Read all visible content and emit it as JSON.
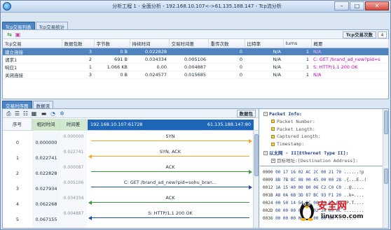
{
  "window": {
    "title": "分析工程 1 - 全面分析 - 192.168.10.107<->61.135.188.147 - Tcp流分析",
    "minimize": "–",
    "maximize": "□",
    "close": "✕"
  },
  "top_tabs": [
    "Tcp交易列表",
    "Tcp交易统计"
  ],
  "top_toolbar": {
    "count_label": "Tcp交易次数",
    "count_value": "4"
  },
  "tcp_table": {
    "headers": [
      "Tcp交易",
      "数据包数",
      "字节数",
      "持续时间",
      "交易时间差",
      "重传次数",
      "比特率",
      "turns",
      "概要"
    ],
    "rows": [
      {
        "name": "建立连接",
        "packets": "3",
        "bytes": "0 B",
        "duration": "0.022828",
        "gap": "",
        "retrans": "0",
        "bitrate": "N/A",
        "turns": "1",
        "summary": "N/A"
      },
      {
        "name": "请求1",
        "packets": "2",
        "bytes": "691 B",
        "duration": "0.034334",
        "gap": "0.005106",
        "retrans": "0",
        "bitrate": "N/A",
        "turns": "1",
        "summary": "C: GET /brand_ad_new?pid=s"
      },
      {
        "name": "响应1",
        "packets": "1",
        "bytes": "1.066 KB",
        "duration": "0.00",
        "gap": "0.004887",
        "retrans": "0",
        "bitrate": "N/A",
        "turns": "1",
        "summary": "S: HTTP/1.1 200 OK"
      },
      {
        "name": "关闭连接",
        "packets": "3",
        "bytes": "0 B",
        "duration": "0.024577",
        "gap": "0.015685",
        "retrans": "0",
        "bitrate": "N/A",
        "turns": "1",
        "summary": "N/A"
      }
    ]
  },
  "lower_tabs": [
    "交易时序图",
    "数据流"
  ],
  "flow": {
    "packet_label": "数据包",
    "headers": {
      "seq": "序号",
      "relative": "相对时间",
      "delta": "时间差"
    },
    "client_ip": "192.168.10.107:61728",
    "server_ip": "61.135.188.147:80",
    "rows": [
      {
        "seq": "0",
        "relative": "0.000000",
        "delta": "0.000000",
        "label": "SYN",
        "dir": "right",
        "color": "#f5a623"
      },
      {
        "seq": "1",
        "relative": "0.022741",
        "delta": "0.022741",
        "label": "SYN, ACK",
        "dir": "left",
        "color": "#f5a623"
      },
      {
        "seq": "2",
        "relative": "0.022828",
        "delta": "0.000087",
        "label": "ACK",
        "dir": "right",
        "color": "#3a9a3a"
      },
      {
        "seq": "3",
        "relative": "0.027934",
        "delta": "0.005106",
        "label": "C: GET /brand_ad_new?pid=sohu_bran...",
        "dir": "right",
        "color": "#1f4fa8"
      },
      {
        "seq": "4",
        "relative": "0.062268",
        "delta": "0.034334",
        "label": "ACK",
        "dir": "left",
        "color": "#3a9a3a"
      },
      {
        "seq": "5",
        "relative": "0.067155",
        "delta": "0.004887",
        "label": "S: HTTP/1.1 200 OK",
        "dir": "left",
        "color": "#1f4fa8"
      }
    ]
  },
  "decode_tree": [
    {
      "text": "Packet Info:",
      "level": 0,
      "kind": "box",
      "sign": "−"
    },
    {
      "text": "Packet Number:",
      "level": 1,
      "kind": "leaf"
    },
    {
      "text": "Packet Length:",
      "level": 1,
      "kind": "leaf"
    },
    {
      "text": "Captured Length:",
      "level": 1,
      "kind": "leaf"
    },
    {
      "text": "Timestamp:",
      "level": 1,
      "kind": "leaf"
    },
    {
      "text": "以太网 - II[Ethernet Type II]:",
      "level": 0,
      "kind": "box",
      "sign": "−"
    },
    {
      "text": "目标地址:[Destination Address]:",
      "level": 1,
      "kind": "box",
      "sign": "+"
    }
  ],
  "hex_dump": [
    {
      "offset": "0000",
      "hex": "00 17 16 02 AC 2C 00 21 70",
      "ascii": "......!p"
    },
    {
      "offset": "0009",
      "hex": "8B 7B 8C 08 00 45 00 00 28",
      "ascii": ".{...E..("
    },
    {
      "offset": "0012",
      "hex": "1A 15 40 00 80 06 C2 C0 C0",
      "ascii": "..@....."
    },
    {
      "offset": "001B",
      "hex": "A8 0A 6B 3D 87 BC 93 F1 20",
      "ascii": "..k=...."
    },
    {
      "offset": "0024",
      "hex": "00 50 14 54 8C 00 00 00 00",
      "ascii": ".P.T...."
    },
    {
      "offset": "002D",
      "hex": "00 00 00 00 04 02 20 00 AC",
      "ascii": "........"
    },
    {
      "offset": "0036",
      "hex": "00 00 00 00 00 00 00 00",
      "ascii": "........"
    }
  ],
  "watermark": {
    "title": "安全网",
    "url": "linuxso.com"
  }
}
